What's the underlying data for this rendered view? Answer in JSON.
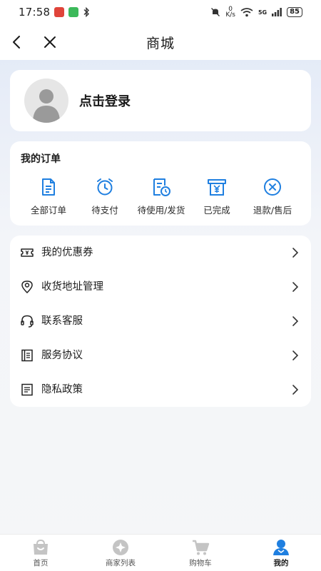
{
  "status_bar": {
    "time": "17:58",
    "net_speed_top": "0",
    "net_speed_unit": "K/s",
    "network_type": "5G",
    "battery": "85"
  },
  "nav": {
    "title": "商城",
    "back_icon": "chevron-left-icon",
    "close_icon": "close-icon"
  },
  "login": {
    "label": "点击登录",
    "avatar_icon": "default-avatar-icon"
  },
  "orders": {
    "title": "我的订单",
    "items": [
      {
        "label": "全部订单",
        "icon": "document-icon"
      },
      {
        "label": "待支付",
        "icon": "alarm-clock-icon"
      },
      {
        "label": "待使用/发货",
        "icon": "pending-icon"
      },
      {
        "label": "已完成",
        "icon": "receipt-yen-icon"
      },
      {
        "label": "退款/售后",
        "icon": "cancel-circle-icon"
      }
    ]
  },
  "menu": {
    "items": [
      {
        "label": "我的优惠券",
        "icon": "coupon-icon"
      },
      {
        "label": "收货地址管理",
        "icon": "location-pin-icon"
      },
      {
        "label": "联系客服",
        "icon": "headset-icon"
      },
      {
        "label": "服务协议",
        "icon": "book-icon"
      },
      {
        "label": "隐私政策",
        "icon": "policy-doc-icon"
      }
    ]
  },
  "tabs": [
    {
      "label": "首页",
      "icon": "home-bag-icon",
      "active": false
    },
    {
      "label": "商家列表",
      "icon": "store-list-icon",
      "active": false
    },
    {
      "label": "购物车",
      "icon": "cart-icon",
      "active": false
    },
    {
      "label": "我的",
      "icon": "profile-icon",
      "active": true
    }
  ],
  "colors": {
    "accent": "#1f7fe0",
    "tab_inactive": "#c4c4c4",
    "text": "#1c1c1c"
  }
}
